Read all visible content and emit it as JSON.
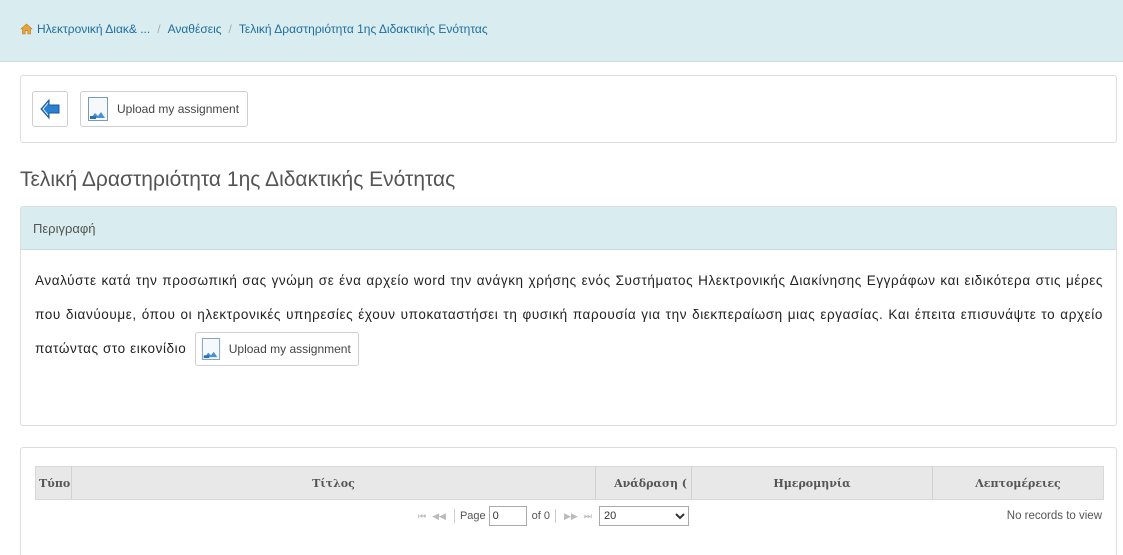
{
  "breadcrumb": {
    "items": [
      "Ηλεκτρονική Διακ& ...",
      "Αναθέσεις",
      "Τελική Δραστηριότητα 1ης Διδακτικής Ενότητας"
    ],
    "separator": "/"
  },
  "toolbar": {
    "upload_label": "Upload my assignment"
  },
  "page_title": "Τελική Δραστηριότητα 1ης Διδακτικής Ενότητας",
  "description": {
    "header": "Περιγραφή",
    "text": "Αναλύστε κατά την προσωπική σας γνώμη σε ένα αρχείο word την ανάγκη χρήσης ενός Συστήματος Ηλεκτρονικής Διακίνησης Εγγράφων και ειδικότερα στις μέρες που διανύουμε, όπου οι ηλεκτρονικές υπηρεσίες έχουν υποκαταστήσει τη φυσική παρουσία για την διεκπεραίωση μιας εργασίας. Και έπειτα επισυνάψτε το αρχείο πατώντας στο εικονίδιο",
    "inline_button_label": "Upload my assignment"
  },
  "grid": {
    "columns": [
      "Τύπο",
      "Τίτλος",
      "Ανάδραση (",
      "Ημερομηνία",
      "Λεπτομέρειες"
    ],
    "pager": {
      "first": "⏮",
      "prev": "◀◀",
      "page_label": "Page",
      "page_value": "0",
      "of_label": "of 0",
      "next": "▶▶",
      "last": "⏭",
      "page_size": "20",
      "page_size_options": [
        "20"
      ],
      "records_text": "No records to view"
    }
  },
  "colors": {
    "header_bg": "#d9ecef",
    "link": "#1f6e9e",
    "arrow_blue": "#2b7fd0",
    "grid_header_bg": "#e8e8e8"
  }
}
